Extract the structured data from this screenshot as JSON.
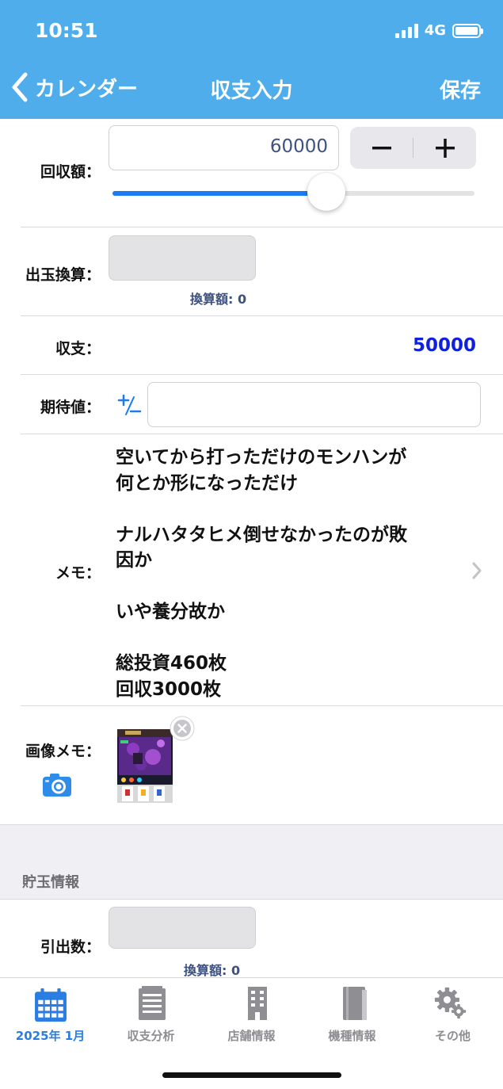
{
  "status_bar": {
    "time": "10:51",
    "network": "4G"
  },
  "nav": {
    "back_label": "カレンダー",
    "title": "収支入力",
    "save_label": "保存"
  },
  "recovery": {
    "label": "回収額：",
    "value": "60000",
    "slider_fraction": 0.59
  },
  "payout_conversion": {
    "label": "出玉換算：",
    "converted_text": "換算額: 0"
  },
  "balance": {
    "label": "収支：",
    "value": "50000",
    "value_color": "#1020e0"
  },
  "expected": {
    "label": "期待値：",
    "value": ""
  },
  "memo": {
    "label": "メモ：",
    "text": "空いてから打っただけのモンハンが\n何とか形になっただけ\n\nナルハタタヒメ倒せなかったのが敗\n因か\n\nいや養分故か\n\n総投資460枚\n回収3000枚"
  },
  "image_memo": {
    "label": "画像メモ："
  },
  "savings": {
    "section_title": "貯玉情報",
    "withdraw_label": "引出数：",
    "converted_text": "換算額: 0"
  },
  "tabs": [
    {
      "label": "2025年 1月",
      "icon": "calendar-icon",
      "active": true
    },
    {
      "label": "収支分析",
      "icon": "document-list-icon",
      "active": false
    },
    {
      "label": "店舗情報",
      "icon": "building-icon",
      "active": false
    },
    {
      "label": "機種情報",
      "icon": "book-icon",
      "active": false
    },
    {
      "label": "その他",
      "icon": "gear-icon",
      "active": false
    }
  ],
  "colors": {
    "nav_bar": "#4eadea",
    "accent": "#1a7bf2",
    "active_tab": "#2a7de1"
  }
}
